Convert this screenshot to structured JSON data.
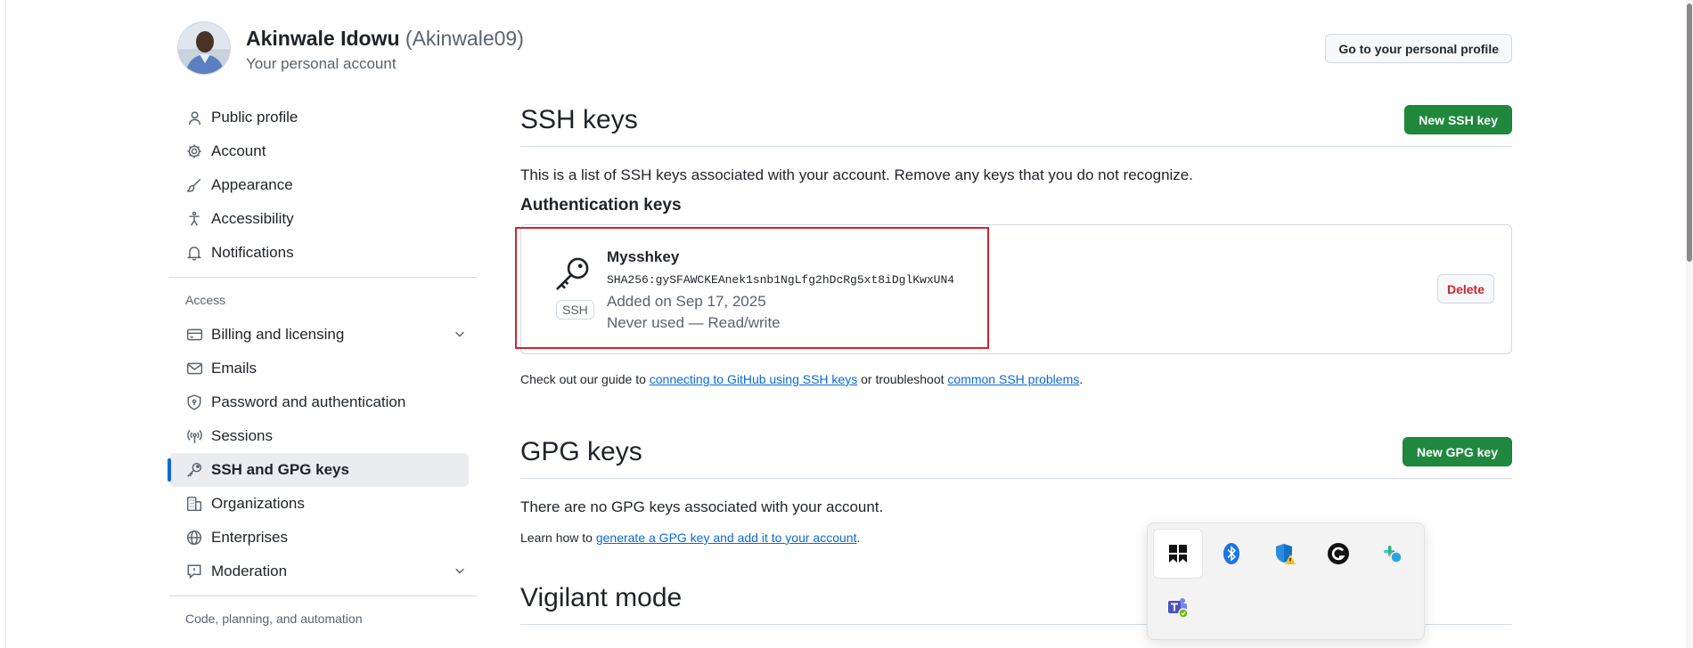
{
  "header": {
    "name": "Akinwale Idowu",
    "login": "(Akinwale09)",
    "subtitle": "Your personal account",
    "profile_button": "Go to your personal profile"
  },
  "sidebar": {
    "items": [
      {
        "label": "Public profile",
        "icon": "person-icon"
      },
      {
        "label": "Account",
        "icon": "gear-icon"
      },
      {
        "label": "Appearance",
        "icon": "paintbrush-icon"
      },
      {
        "label": "Accessibility",
        "icon": "accessibility-icon"
      },
      {
        "label": "Notifications",
        "icon": "bell-icon"
      }
    ],
    "access_heading": "Access",
    "access_items": [
      {
        "label": "Billing and licensing",
        "icon": "credit-card-icon",
        "expandable": true
      },
      {
        "label": "Emails",
        "icon": "mail-icon"
      },
      {
        "label": "Password and authentication",
        "icon": "shield-lock-icon"
      },
      {
        "label": "Sessions",
        "icon": "broadcast-icon"
      },
      {
        "label": "SSH and GPG keys",
        "icon": "key-icon",
        "active": true
      },
      {
        "label": "Organizations",
        "icon": "organization-icon"
      },
      {
        "label": "Enterprises",
        "icon": "globe-icon"
      },
      {
        "label": "Moderation",
        "icon": "report-icon",
        "expandable": true
      }
    ],
    "code_heading": "Code, planning, and automation"
  },
  "ssh": {
    "title": "SSH keys",
    "new_button": "New SSH key",
    "description": "This is a list of SSH keys associated with your account. Remove any keys that you do not recognize.",
    "auth_heading": "Authentication keys",
    "key": {
      "name": "Mysshkey",
      "fingerprint": "SHA256:gySFAWCKEAnek1snb1NgLfg2hDcRg5xt8iDglKwxUN4",
      "added": "Added on Sep 17, 2025",
      "usage": "Never used — Read/write",
      "badge": "SSH",
      "delete_button": "Delete"
    },
    "guide_prefix": "Check out our guide to ",
    "guide_link1": "connecting to GitHub using SSH keys",
    "guide_middle": " or troubleshoot ",
    "guide_link2": "common SSH problems",
    "guide_suffix": "."
  },
  "gpg": {
    "title": "GPG keys",
    "new_button": "New GPG key",
    "empty_text": "There are no GPG keys associated with your account.",
    "learn_prefix": "Learn how to ",
    "learn_link": "generate a GPG key and add it to your account",
    "learn_suffix": "."
  },
  "vigilant": {
    "title": "Vigilant mode"
  },
  "tray": {
    "icons": [
      "windows-app-icon",
      "bluetooth-icon",
      "defender-warning-icon",
      "grammarly-icon",
      "slack-icon",
      "teams-icon"
    ]
  },
  "colors": {
    "accent": "#0969da",
    "green": "#1f883d",
    "danger": "#d1242f",
    "highlight": "#d1242f"
  }
}
